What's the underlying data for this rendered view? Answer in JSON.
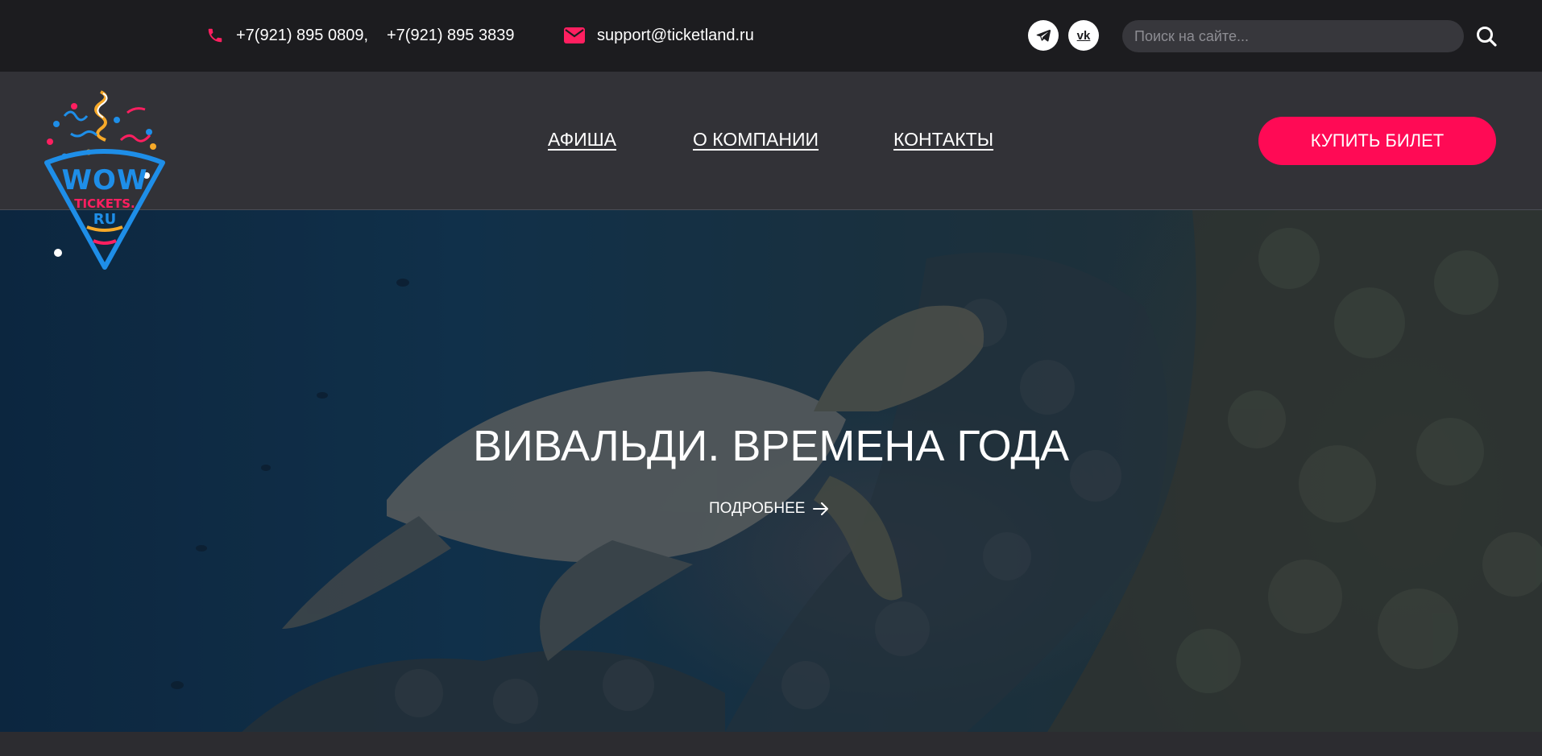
{
  "topbar": {
    "phones": [
      "+7(921) 895 0809,",
      "+7(921) 895 3839"
    ],
    "email": "support@ticketland.ru",
    "social": [
      {
        "name": "telegram",
        "icon": "telegram-icon"
      },
      {
        "name": "vk",
        "icon": "vk-icon",
        "label": "vk"
      }
    ],
    "search": {
      "placeholder": "Поиск на сайте...",
      "value": "",
      "icon": "search-icon"
    }
  },
  "header": {
    "logo": {
      "line1": "WOW",
      "line2": "TICKETS.",
      "line3": "RU"
    },
    "nav": [
      "АФИША",
      "О КОМПАНИИ",
      "КОНТАКТЫ"
    ],
    "buy_label": "КУПИТЬ БИЛЕТ"
  },
  "hero": {
    "title": "ВИВАЛЬДИ. ВРЕМЕНА ГОДА",
    "more_label": "ПОДРОБНЕЕ"
  },
  "colors": {
    "accent": "#ff0a55",
    "topbar_bg": "#1c1c1f",
    "header_bg": "#323237",
    "logo_blue": "#1e8ee8"
  }
}
